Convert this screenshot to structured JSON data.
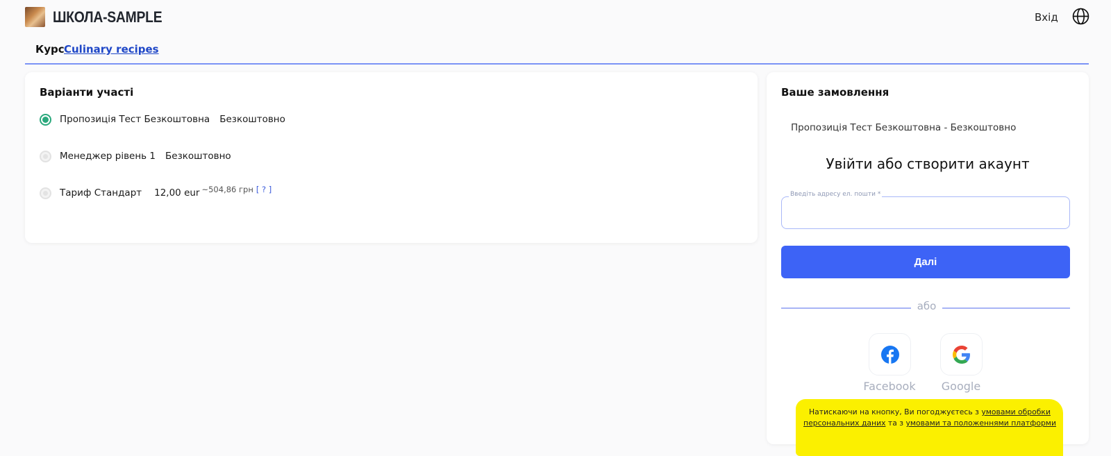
{
  "header": {
    "brand": "ШКОЛА-SAMPLE",
    "login_label": "Вхід"
  },
  "course": {
    "prefix": "Курс",
    "link_label": "Culinary recipes"
  },
  "participation": {
    "title": "Варіанти участі",
    "options": [
      {
        "name": "Пропозиція Тест Безкоштовна",
        "price": "Безкоштовно",
        "selected": true
      },
      {
        "name": "Менеджер рівень 1",
        "price": "Безкоштовно",
        "selected": false
      },
      {
        "name": "Тариф Стандарт",
        "price": "12,00 eur",
        "approx": "~504,86 грн",
        "help": "[ ? ]",
        "selected": false
      }
    ]
  },
  "order": {
    "title": "Ваше замовлення",
    "line": "Пропозиція Тест Безкоштовна - Безкоштовно",
    "auth_title": "Увійти або створити акаунт",
    "email_label": "Введіть адресу ел. пошти *",
    "email_value": "",
    "next_label": "Далі",
    "or_label": "або",
    "social": [
      {
        "label": "Facebook",
        "icon": "facebook-icon"
      },
      {
        "label": "Google",
        "icon": "google-icon"
      }
    ],
    "consent": {
      "before": "Натискаючи на кнопку, Ви погоджуєтесь з ",
      "link1": "умовами обробки персональних даних",
      "middle": " та з ",
      "link2": "умовами та положеннями платформи"
    }
  },
  "colors": {
    "accent": "#3d63f6",
    "selected_radio": "#2aa87c",
    "highlight": "#fbf000",
    "divider": "#7b93f5"
  }
}
